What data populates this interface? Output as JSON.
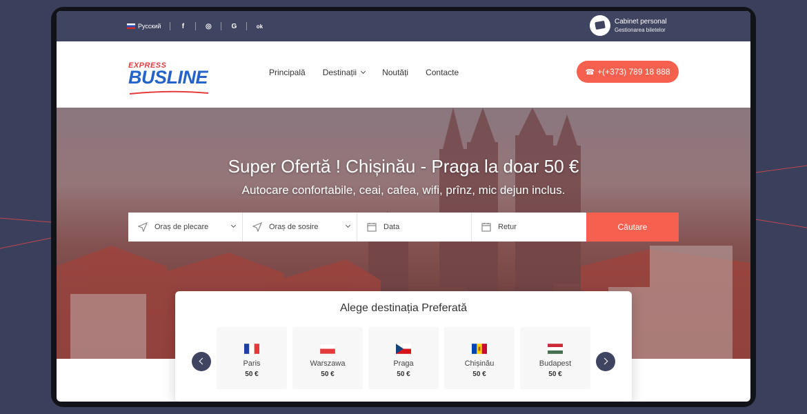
{
  "topbar": {
    "language": "Русский",
    "socials": [
      "f",
      "◎",
      "G",
      "ok"
    ],
    "cabinet_title": "Cabinet personal",
    "cabinet_subtitle": "Gestionarea biletelor"
  },
  "logo": {
    "top": "EXPRESS",
    "main": "BUSLINE"
  },
  "nav": {
    "items": [
      {
        "label": "Principală"
      },
      {
        "label": "Destinații",
        "has_dropdown": true
      },
      {
        "label": "Noutăți"
      },
      {
        "label": "Contacte"
      }
    ]
  },
  "phone": {
    "icon": "phone-icon",
    "number": "(+373) 789 18 888",
    "prefix": "+"
  },
  "hero": {
    "title": "Super Ofertă ! Chișinău - Praga la doar 50 €",
    "subtitle": "Autocare confortabile, ceai, cafea, wifi, prînz, mic dejun inclus."
  },
  "search": {
    "from_placeholder": "Oraș de plecare",
    "to_placeholder": "Oraș de sosire",
    "date_placeholder": "Data",
    "return_placeholder": "Retur",
    "button": "Căutare"
  },
  "destinations": {
    "title": "Alege destinația Preferată",
    "items": [
      {
        "city": "Paris",
        "price": "50 €",
        "flag": "france-flag"
      },
      {
        "city": "Warszawa",
        "price": "50 €",
        "flag": "poland-flag"
      },
      {
        "city": "Praga",
        "price": "50 €",
        "flag": "czech-flag"
      },
      {
        "city": "Chișinău",
        "price": "50 €",
        "flag": "moldova-flag"
      },
      {
        "city": "Budapest",
        "price": "50 €",
        "flag": "hungary-flag"
      }
    ]
  },
  "colors": {
    "accent": "#f6604f",
    "dark": "#3f4460",
    "brand_blue": "#2563c9"
  }
}
